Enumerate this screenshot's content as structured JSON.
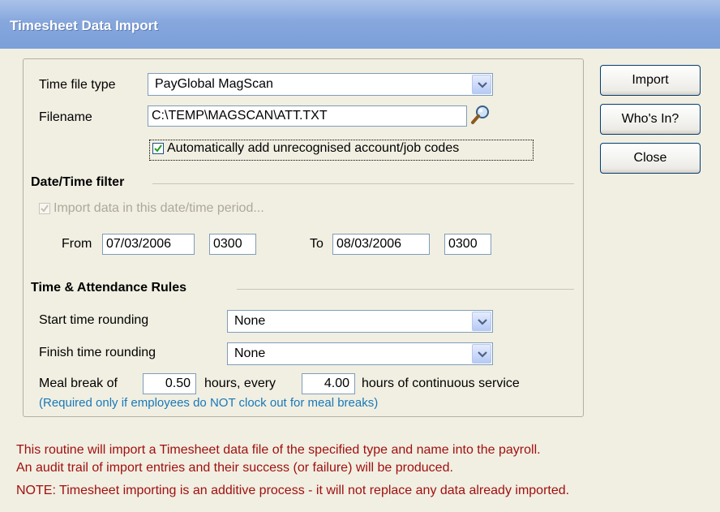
{
  "window": {
    "title": "Timesheet Data Import"
  },
  "fields": {
    "time_file_type": {
      "label": "Time file type",
      "value": "PayGlobal MagScan"
    },
    "filename": {
      "label": "Filename",
      "value": "C:\\TEMP\\MAGSCAN\\ATT.TXT"
    },
    "auto_add": {
      "label": "Automatically add unrecognised account/job codes",
      "checked": true
    }
  },
  "date_filter": {
    "title": "Date/Time filter",
    "checkbox_label": "Import data in this date/time period...",
    "from_label": "From",
    "from_date": "07/03/2006",
    "from_time": "0300",
    "to_label": "To",
    "to_date": "08/03/2006",
    "to_time": "0300"
  },
  "rules": {
    "title": "Time & Attendance Rules",
    "start_label": "Start time rounding",
    "start_value": "None",
    "finish_label": "Finish time rounding",
    "finish_value": "None",
    "meal_prefix": "Meal break of",
    "meal_hours": "0.50",
    "meal_mid": "hours, every",
    "meal_every": "4.00",
    "meal_suffix": "hours of continuous service",
    "hint": "(Required only if employees do NOT clock out for meal breaks)"
  },
  "buttons": {
    "import": "Import",
    "whos_in": "Who's In?",
    "close": "Close"
  },
  "notes": {
    "line1": "This routine will import a Timesheet data file of the specified type and name into the payroll.",
    "line2": "An audit trail of import entries and their success (or failure) will be produced.",
    "line3": "NOTE: Timesheet importing is an additive process - it will not replace any data already imported."
  },
  "icons": {
    "dropdown": "chevron-down-icon",
    "browse": "magnifier-icon",
    "check": "check-icon"
  },
  "colors": {
    "note": "#a01010",
    "hint": "#1878b8",
    "title_bar": "#7c9fd9"
  }
}
